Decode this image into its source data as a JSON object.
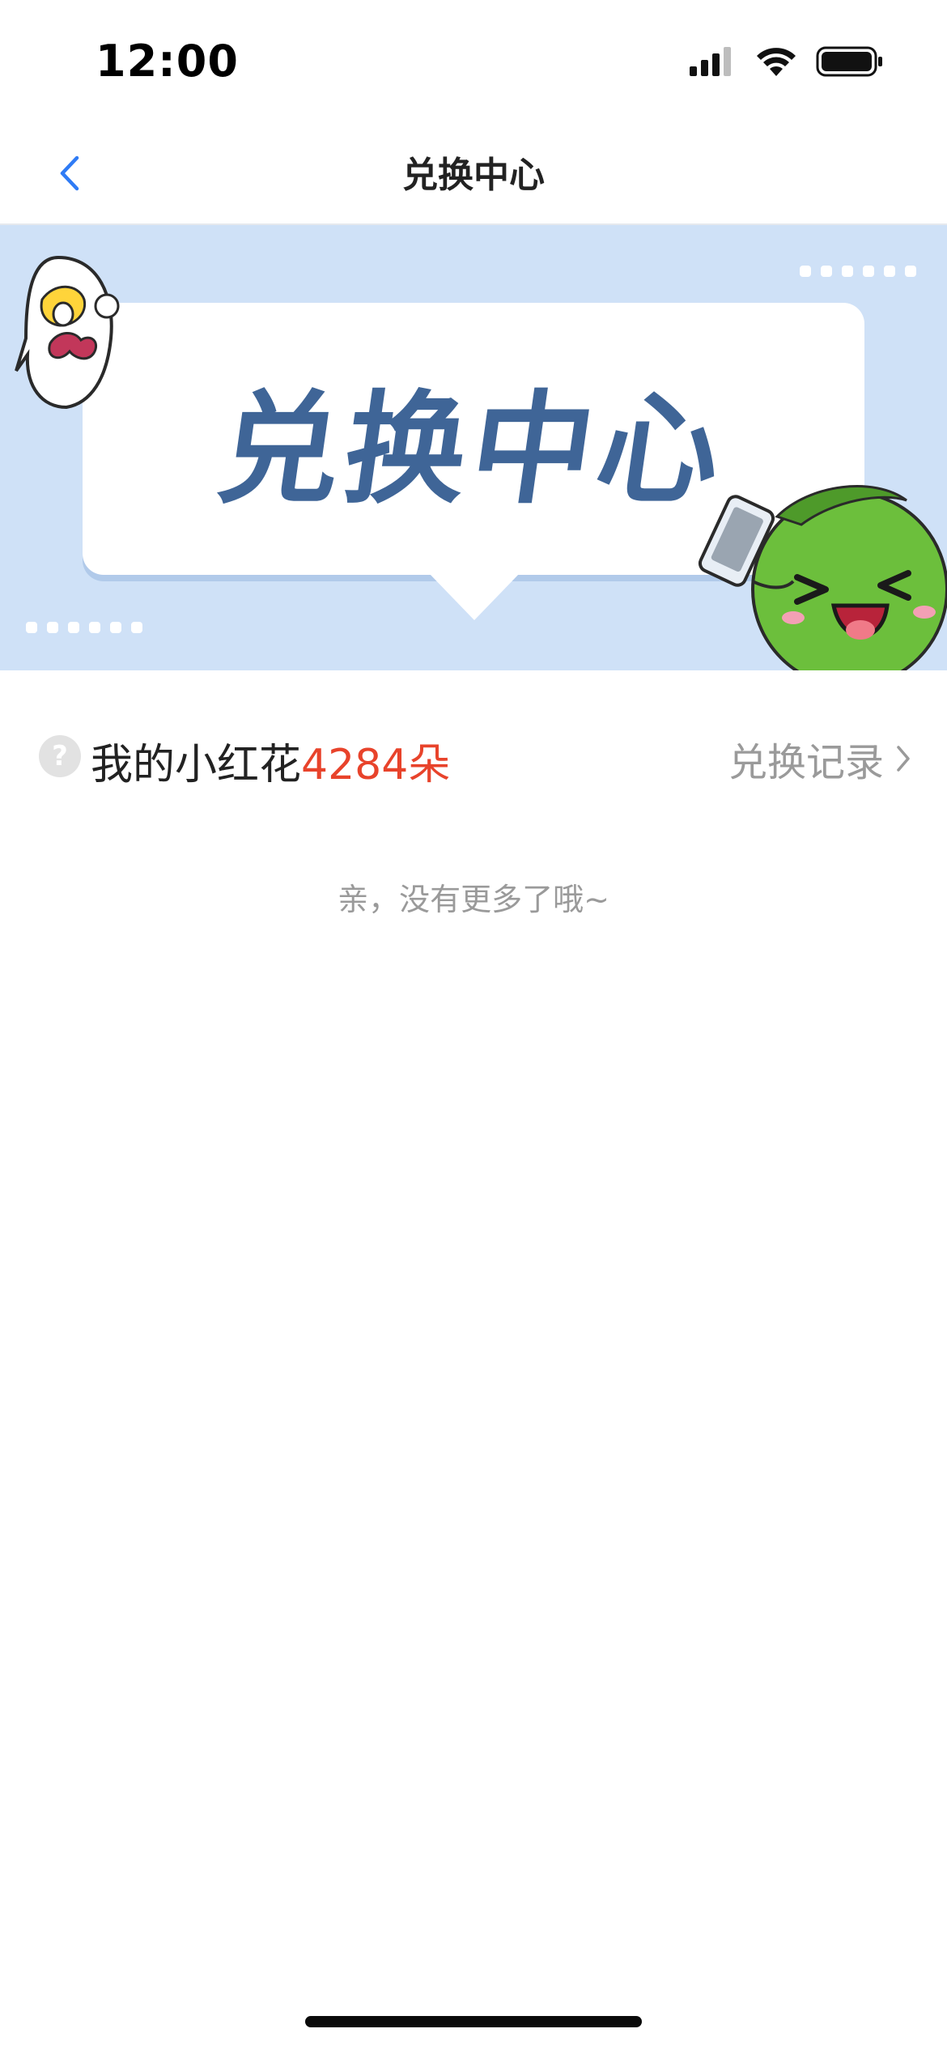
{
  "status_bar": {
    "time": "12:00"
  },
  "nav": {
    "title": "兑换中心"
  },
  "banner": {
    "title": "兑换中心"
  },
  "flowers": {
    "label": "我的小红花",
    "count": "4284朵",
    "help_symbol": "?",
    "record_label": "兑换记录"
  },
  "list": {
    "empty_message": "亲，没有更多了哦~"
  },
  "colors": {
    "accent_red": "#e8432b",
    "banner_bg": "#cfe1f7",
    "banner_text": "#3f6597",
    "back_blue": "#2f7bf5"
  }
}
